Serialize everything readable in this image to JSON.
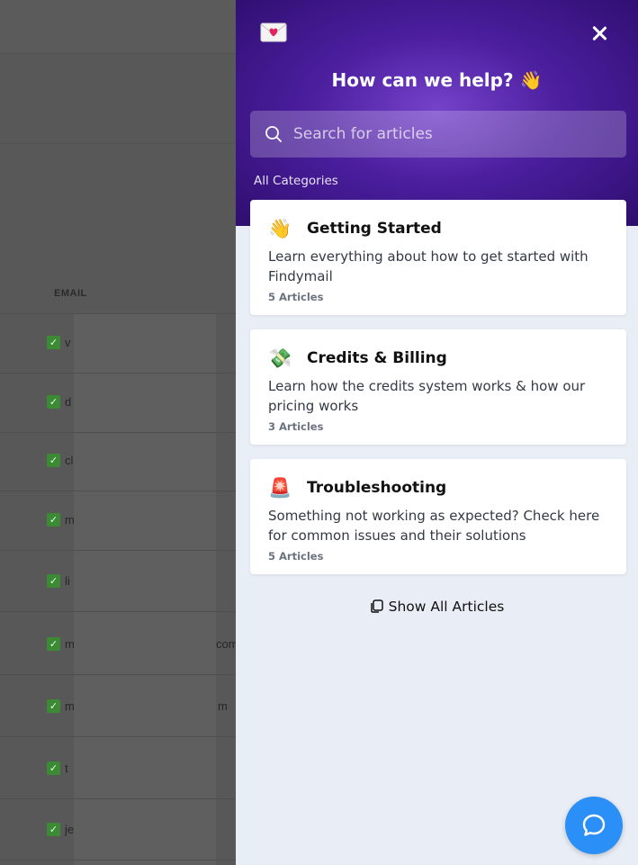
{
  "background_app": {
    "column_header": "EMAIL",
    "rows": [
      {
        "prefix": "v"
      },
      {
        "prefix": "d"
      },
      {
        "prefix": "cl"
      },
      {
        "prefix": "m"
      },
      {
        "prefix": "li"
      },
      {
        "prefix": "m",
        "suffix": "com"
      },
      {
        "prefix": "m",
        "suffix": "m"
      },
      {
        "prefix": "t"
      },
      {
        "prefix": "je"
      }
    ]
  },
  "help_panel": {
    "title": "How can we help? 👋",
    "search": {
      "placeholder": "Search for articles"
    },
    "categories_label": "All Categories",
    "categories": [
      {
        "emoji": "👋",
        "title": "Getting Started",
        "description": "Learn everything about how to get started with Findymail",
        "count": "5 Articles"
      },
      {
        "emoji": "💸",
        "title": "Credits & Billing",
        "description": "Learn how the credits system works & how our pricing works",
        "count": "3 Articles"
      },
      {
        "emoji": "🚨",
        "title": "Troubleshooting",
        "description": "Something not working as expected? Check here for common issues and their solutions",
        "count": "5 Articles"
      }
    ],
    "show_all_label": "Show All Articles"
  },
  "colors": {
    "header_purple": "#4b1e9e",
    "panel_bg": "#e9edf5",
    "chat_button": "#2a8ff7"
  },
  "icons": [
    "envelope-heart-icon",
    "close-icon",
    "search-icon",
    "copy-icon",
    "chat-bubble-icon"
  ]
}
